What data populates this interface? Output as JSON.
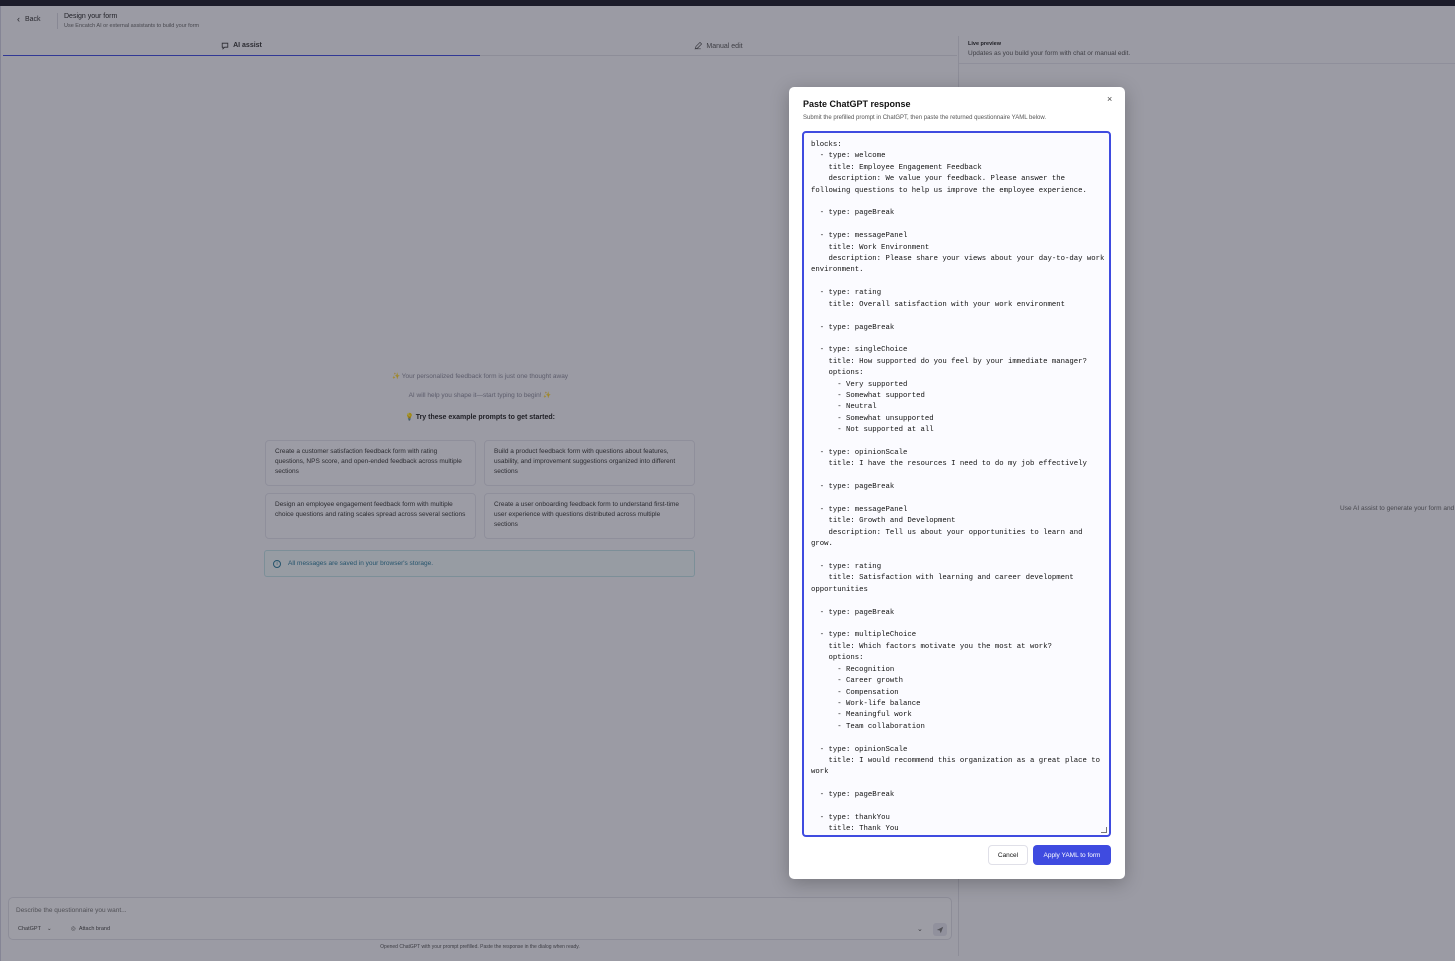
{
  "header": {
    "back_label": "Back",
    "title": "Design your form",
    "subtitle": "Use Encatch AI or external assistants to build your form"
  },
  "tabs": {
    "ai_assist": "AI assist",
    "manual_edit": "Manual edit"
  },
  "preview": {
    "title": "Live preview",
    "subtitle": "Updates as you build your form with chat or manual edit.",
    "hint": "Use AI assist to generate your form and"
  },
  "empty_state": {
    "line1": "✨ Your personalized feedback form is just one thought away",
    "line2": "AI will help you shape it—start typing to begin! ✨",
    "prompts_heading": "💡 Try these example prompts to get started:",
    "prompts": [
      "Create a customer satisfaction feedback form with rating questions, NPS score, and open-ended feedback across multiple sections",
      "Build a product feedback form with questions about features, usability, and improvement suggestions organized into different sections",
      "Design an employee engagement feedback form with multiple choice questions and rating scales spread across several sections",
      "Create a user onboarding feedback form to understand first-time user experience with questions distributed across multiple sections"
    ],
    "notice": "All messages are saved in your browser's storage."
  },
  "composer": {
    "placeholder": "Describe the questionnaire you want...",
    "model": "ChatGPT",
    "attach_label": "Attach brand",
    "footer_note": "Opened ChatGPT with your prompt prefilled. Paste the response in the dialog when ready."
  },
  "modal": {
    "title": "Paste ChatGPT response",
    "subtitle": "Submit the prefilled prompt in ChatGPT, then paste the returned questionnaire YAML below.",
    "yaml": "blocks:\n  - type: welcome\n    title: Employee Engagement Feedback\n    description: We value your feedback. Please answer the following questions to help us improve the employee experience.\n\n  - type: pageBreak\n\n  - type: messagePanel\n    title: Work Environment\n    description: Please share your views about your day-to-day work environment.\n\n  - type: rating\n    title: Overall satisfaction with your work environment\n\n  - type: pageBreak\n\n  - type: singleChoice\n    title: How supported do you feel by your immediate manager?\n    options:\n      - Very supported\n      - Somewhat supported\n      - Neutral\n      - Somewhat unsupported\n      - Not supported at all\n\n  - type: opinionScale\n    title: I have the resources I need to do my job effectively\n\n  - type: pageBreak\n\n  - type: messagePanel\n    title: Growth and Development\n    description: Tell us about your opportunities to learn and grow.\n\n  - type: rating\n    title: Satisfaction with learning and career development opportunities\n\n  - type: pageBreak\n\n  - type: multipleChoice\n    title: Which factors motivate you the most at work?\n    options:\n      - Recognition\n      - Career growth\n      - Compensation\n      - Work-life balance\n      - Meaningful work\n      - Team collaboration\n\n  - type: opinionScale\n    title: I would recommend this organization as a great place to work\n\n  - type: pageBreak\n\n  - type: thankYou\n    title: Thank You\n    description: Your feedback is appreciated and will help improve the employee experience.",
    "cancel_label": "Cancel",
    "apply_label": "Apply YAML to form"
  },
  "colors": {
    "accent": "#3f4be0",
    "info": "#2b7a9a"
  }
}
